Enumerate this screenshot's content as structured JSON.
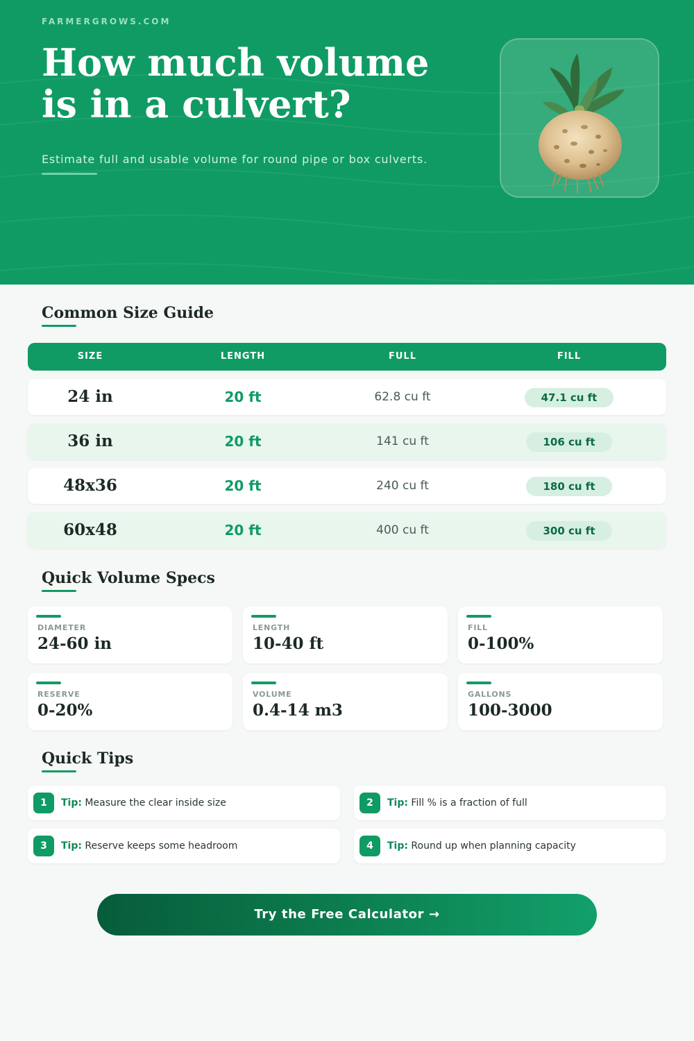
{
  "hero": {
    "brand": "FARMERGROWS.COM",
    "title_line1": "How much volume",
    "title_line2": "is in a culvert?",
    "subtitle": "Estimate full and usable volume for round pipe or box culverts.",
    "image_icon": "celeriac-illustration"
  },
  "size_guide": {
    "title": "Common Size Guide",
    "headers": [
      "SIZE",
      "LENGTH",
      "FULL",
      "FILL"
    ],
    "rows": [
      {
        "size": "24 in",
        "length": "20 ft",
        "full": "62.8 cu ft",
        "fill": "47.1 cu ft"
      },
      {
        "size": "36 in",
        "length": "20 ft",
        "full": "141 cu ft",
        "fill": "106 cu ft"
      },
      {
        "size": "48x36",
        "length": "20 ft",
        "full": "240 cu ft",
        "fill": "180 cu ft"
      },
      {
        "size": "60x48",
        "length": "20 ft",
        "full": "400 cu ft",
        "fill": "300 cu ft"
      }
    ]
  },
  "specs": {
    "title": "Quick Volume Specs",
    "items": [
      {
        "label": "DIAMETER",
        "value": "24-60 in"
      },
      {
        "label": "LENGTH",
        "value": "10-40 ft"
      },
      {
        "label": "FILL",
        "value": "0-100%"
      },
      {
        "label": "RESERVE",
        "value": "0-20%"
      },
      {
        "label": "VOLUME",
        "value": "0.4-14 m3"
      },
      {
        "label": "GALLONS",
        "value": "100-3000"
      }
    ]
  },
  "tips": {
    "title": "Quick Tips",
    "prefix": "Tip:",
    "items": [
      {
        "num": "1",
        "text": "Measure the clear inside size"
      },
      {
        "num": "2",
        "text": "Fill % is a fraction of full"
      },
      {
        "num": "3",
        "text": "Reserve keeps some headroom"
      },
      {
        "num": "4",
        "text": "Round up when planning capacity"
      }
    ]
  },
  "cta": {
    "label": "Try the Free Calculator →"
  },
  "colors": {
    "primary": "#109b64",
    "dark": "#075c3a",
    "pill": "#d6efe1",
    "alt_row": "#e8f6ee"
  }
}
